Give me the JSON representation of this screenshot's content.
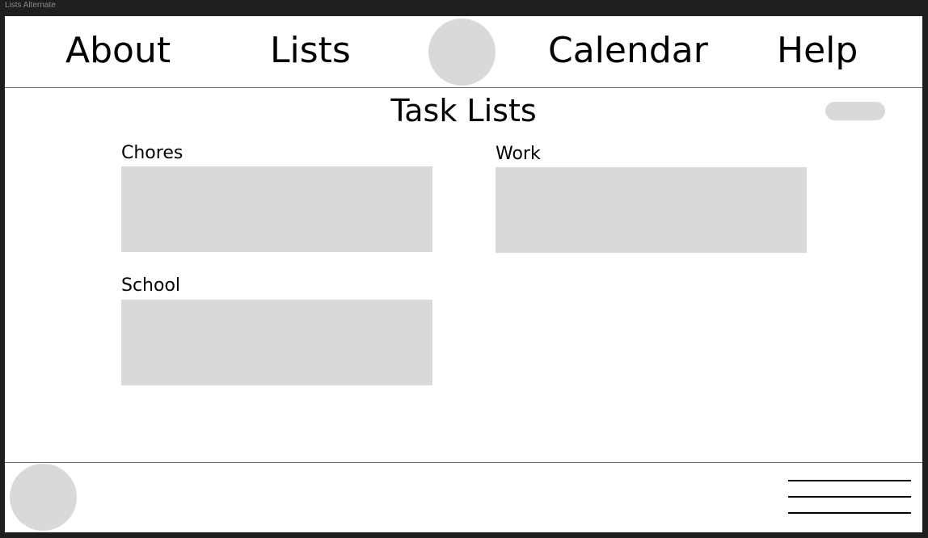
{
  "frame": {
    "title": "Lists Alternate"
  },
  "header": {
    "nav": {
      "about": "About",
      "lists": "Lists",
      "calendar": "Calendar",
      "help": "Help"
    }
  },
  "main": {
    "title": "Task Lists",
    "lists": [
      {
        "label": "Chores"
      },
      {
        "label": "Work"
      },
      {
        "label": "School"
      }
    ]
  },
  "colors": {
    "placeholder": "#d9d9d9",
    "background": "#ffffff",
    "frame_bg": "#1e1e1e",
    "divider": "#6b6b6b"
  },
  "icons": {
    "logo": "logo-placeholder-circle",
    "avatar": "avatar-placeholder-circle",
    "menu": "hamburger-menu-icon"
  }
}
